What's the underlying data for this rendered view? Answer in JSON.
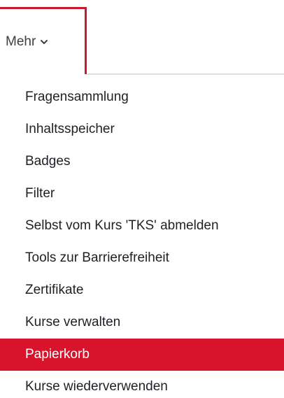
{
  "nav": {
    "more_tab_label": "Mehr",
    "more_tab_icon": "chevron-down-icon",
    "accent_color": "#d7142b"
  },
  "dropdown": {
    "items": [
      {
        "label": "Fragensammlung",
        "active": false
      },
      {
        "label": "Inhaltsspeicher",
        "active": false
      },
      {
        "label": "Badges",
        "active": false
      },
      {
        "label": "Filter",
        "active": false
      },
      {
        "label": "Selbst vom Kurs 'TKS' abmelden",
        "active": false
      },
      {
        "label": "Tools zur Barrierefreiheit",
        "active": false
      },
      {
        "label": "Zertifikate",
        "active": false
      },
      {
        "label": "Kurse verwalten",
        "active": false
      },
      {
        "label": "Papierkorb",
        "active": true
      },
      {
        "label": "Kurse wiederverwenden",
        "active": false
      }
    ]
  }
}
